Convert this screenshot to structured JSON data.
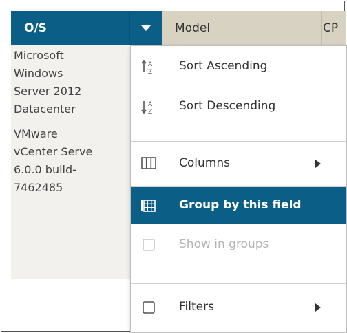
{
  "grid": {
    "columns": [
      {
        "label": "O/S"
      },
      {
        "label": "Model"
      },
      {
        "label": "CP"
      }
    ],
    "os_values": [
      {
        "lines": [
          "Microsoft",
          "Windows",
          "Server 2012",
          "Datacenter"
        ]
      },
      {
        "lines": [
          "VMware",
          "vCenter Serve",
          "6.0.0 build-",
          "7462485"
        ]
      }
    ],
    "clipped_glyphs": [
      "n",
      "F",
      ".",
      "n",
      "F",
      "o"
    ]
  },
  "menu": {
    "items": [
      {
        "label": "Sort Ascending",
        "icon": "sort-ascending-icon",
        "state": "normal"
      },
      {
        "label": "Sort Descending",
        "icon": "sort-descending-icon",
        "state": "normal"
      },
      {
        "label": "Columns",
        "icon": "columns-icon",
        "state": "normal",
        "submenu": true
      },
      {
        "label": "Group by this field",
        "icon": "group-icon",
        "state": "active"
      },
      {
        "label": "Show in groups",
        "icon": "checkbox-icon",
        "state": "disabled"
      },
      {
        "label": "Filters",
        "icon": "checkbox-icon",
        "state": "normal",
        "submenu": true
      }
    ]
  },
  "colors": {
    "header_active": "#0b5f87",
    "header_inactive": "#d8d2c3",
    "grid_background": "#f2f1ee",
    "menu_active": "#0b5f87"
  }
}
